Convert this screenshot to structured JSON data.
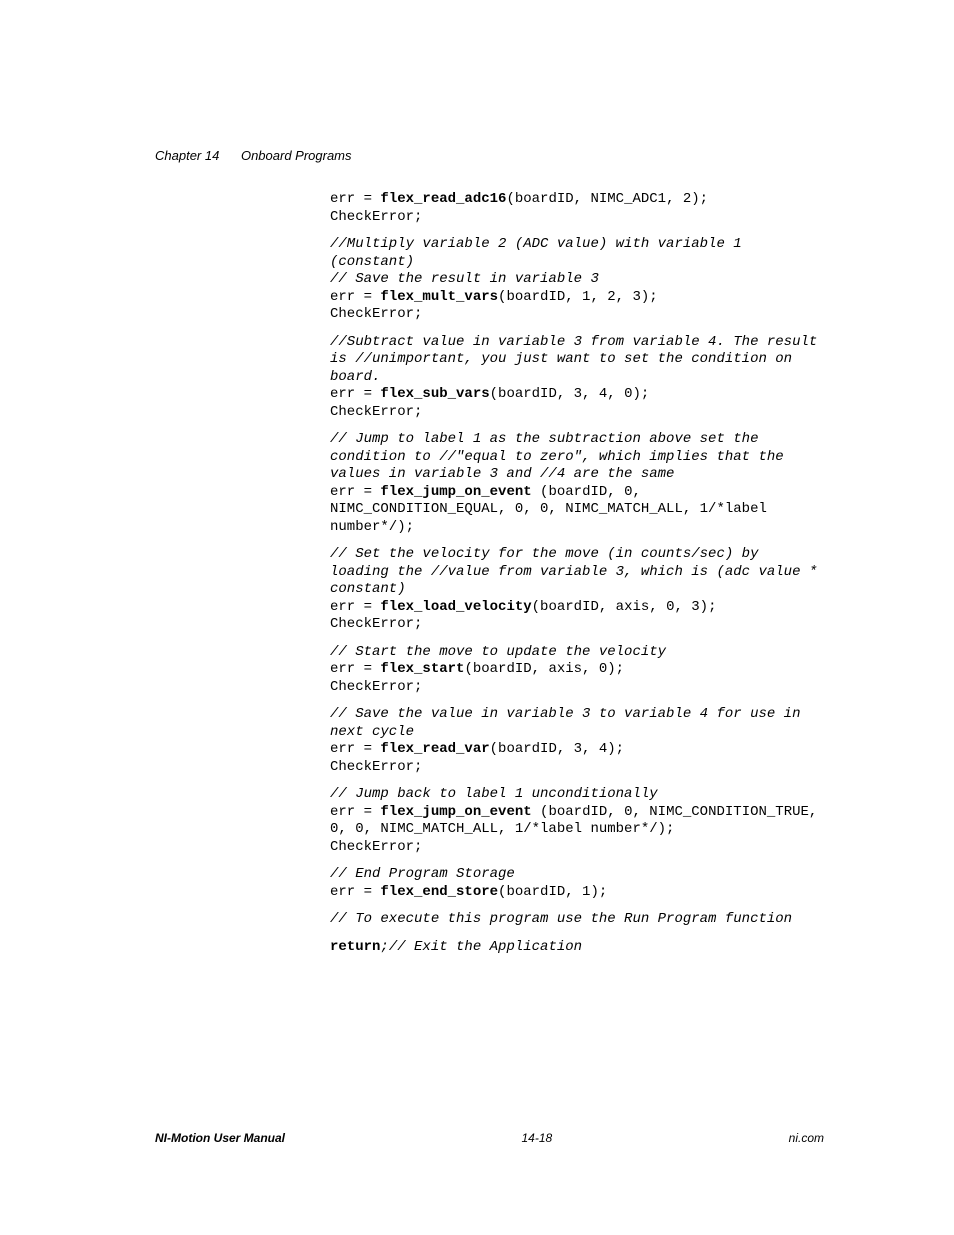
{
  "header": {
    "chapter": "Chapter 14",
    "title": "Onboard Programs"
  },
  "code": {
    "l1a": "err = ",
    "l1b": "flex_read_adc16",
    "l1c": "(boardID, NIMC_ADC1, 2);\nCheckError;",
    "c1": "//Multiply variable 2 (ADC value) with variable 1 (constant)\n// Save the result in variable 3",
    "l2a": "err = ",
    "l2b": "flex_mult_vars",
    "l2c": "(boardID, 1, 2, 3);\nCheckError;",
    "c2": "//Subtract value in variable 3 from variable 4. The result is //unimportant, you just want to set the condition on board.",
    "l3a": "err = ",
    "l3b": "flex_sub_vars",
    "l3c": "(boardID, 3, 4, 0);\nCheckError;",
    "c3": "// Jump to label 1 as the subtraction above set the condition to //\"equal to zero\", which implies that the values in variable 3 and //4 are the same",
    "l4a": "err = ",
    "l4b": "flex_jump_on_event",
    "l4c": " (boardID, 0, NIMC_CONDITION_EQUAL, 0, 0, NIMC_MATCH_ALL, 1/*label number*/);",
    "c4": "// Set the velocity for the move (in counts/sec) by loading the //value from variable 3, which is (adc value * constant)",
    "l5a": "err = ",
    "l5b": "flex_load_velocity",
    "l5c": "(boardID, axis, 0, 3);\nCheckError;",
    "c5": "// Start the move to update the velocity",
    "l6a": "err = ",
    "l6b": "flex_start",
    "l6c": "(boardID, axis, 0);\nCheckError;",
    "c6": "// Save the value in variable 3 to variable 4 for use in next cycle",
    "l7a": "err = ",
    "l7b": "flex_read_var",
    "l7c": "(boardID, 3, 4);\nCheckError;",
    "c7": "// Jump back to label 1 unconditionally",
    "l8a": "err = ",
    "l8b": "flex_jump_on_event",
    "l8c": " (boardID, 0, NIMC_CONDITION_TRUE, 0, 0, NIMC_MATCH_ALL, 1/*label number*/);\nCheckError;",
    "c8": "// End Program Storage",
    "l9a": "err = ",
    "l9b": "flex_end_store",
    "l9c": "(boardID, 1);",
    "c9": "// To execute this program use the Run Program function",
    "ret": "return",
    "retc": ";// Exit the Application"
  },
  "footer": {
    "left": "NI-Motion User Manual",
    "center": "14-18",
    "right": "ni.com"
  }
}
